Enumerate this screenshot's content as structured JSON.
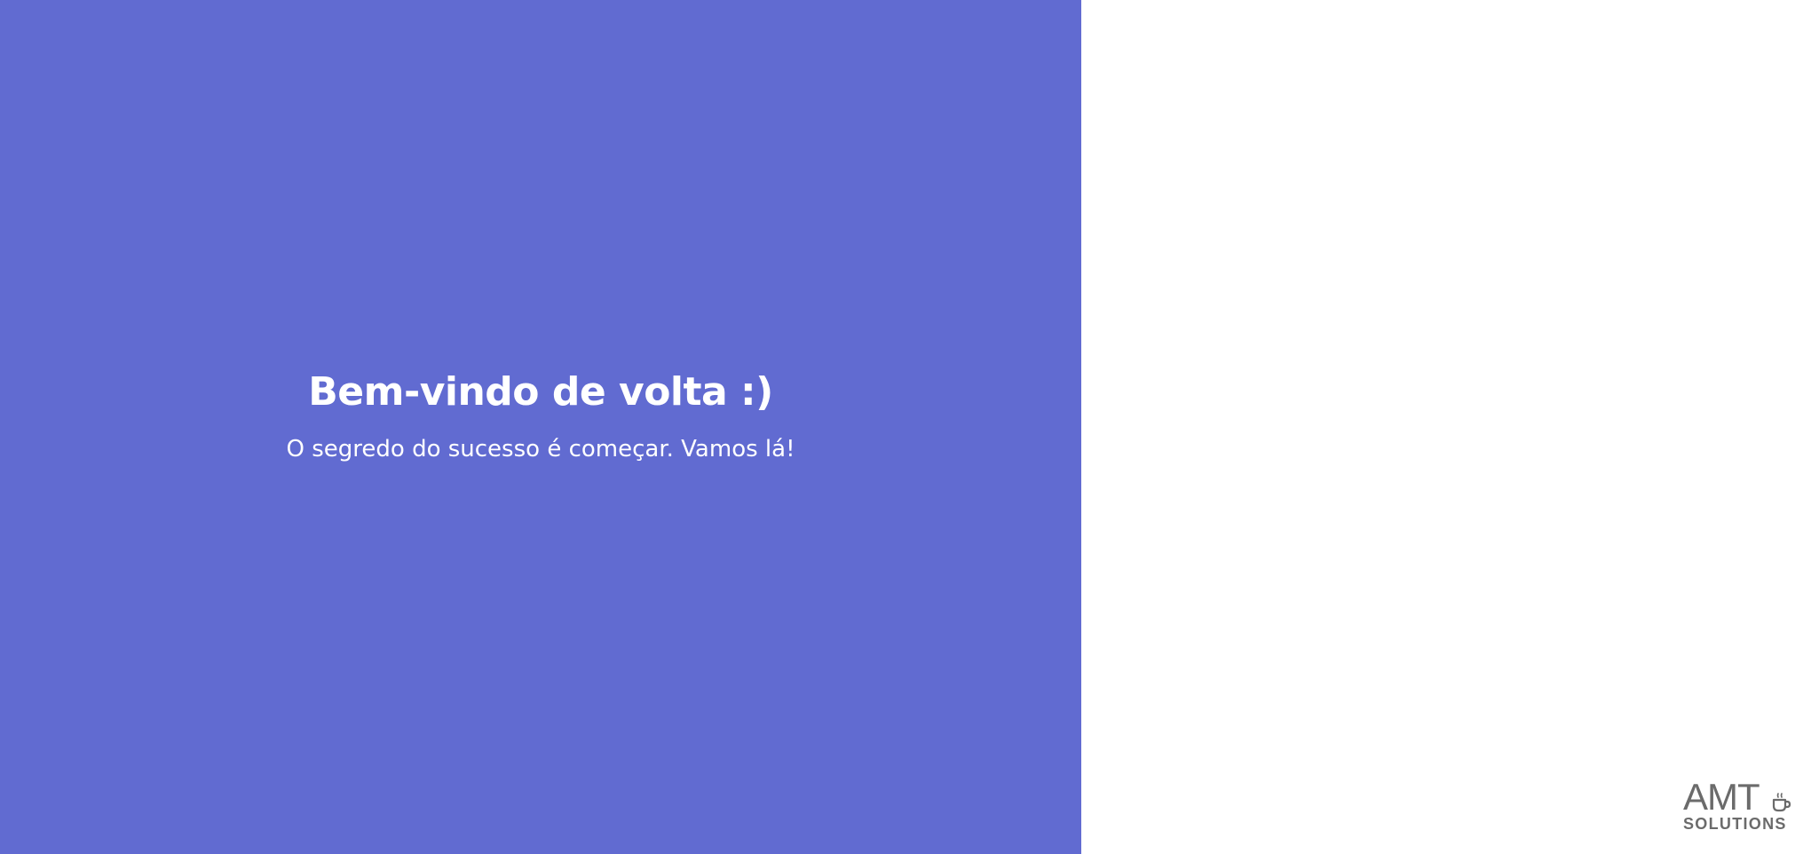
{
  "welcome": {
    "title": "Bem-vindo de volta :)",
    "subtitle": "O segredo do sucesso é começar. Vamos lá!"
  },
  "logo": {
    "wordmark": "AMT",
    "tagline": "SOLUTIONS",
    "icon": "coffee-cup-icon"
  },
  "colors": {
    "panel_background": "#616bd1",
    "panel_text": "#ffffff",
    "page_background": "#ffffff",
    "logo_color": "#6b6b6b"
  }
}
